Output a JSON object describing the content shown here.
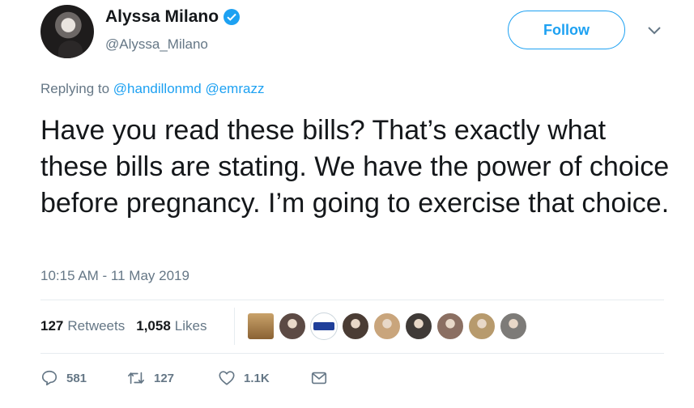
{
  "user": {
    "display_name": "Alyssa Milano",
    "handle": "@Alyssa_Milano",
    "verified_icon": "verified-badge-icon"
  },
  "follow_label": "Follow",
  "reply_context": {
    "prefix": "Replying to",
    "mentions": [
      "@handillonmd",
      "@emrazz"
    ]
  },
  "tweet": {
    "text": "Have you read these bills? That’s exactly what these bills are stating. We have the power of choice before pregnancy. I’m going to exercise that choice.",
    "timestamp": "10:15 AM - 11 May 2019"
  },
  "stats": {
    "retweets_count": "127",
    "retweets_label": "Retweets",
    "likes_count": "1,058",
    "likes_label": "Likes"
  },
  "likers": [
    {
      "icon": "tv-avatar",
      "color": "#a87b44"
    },
    {
      "icon": "avatar",
      "color": "#5c4a44"
    },
    {
      "icon": "sign-avatar",
      "color": "#1f3f9a"
    },
    {
      "icon": "avatar",
      "color": "#4a3c34"
    },
    {
      "icon": "avatar",
      "color": "#c9a57c"
    },
    {
      "icon": "avatar",
      "color": "#3f3a37"
    },
    {
      "icon": "avatar",
      "color": "#8b6f62"
    },
    {
      "icon": "avatar",
      "color": "#b79a6d"
    },
    {
      "icon": "avatar",
      "color": "#7d7b78"
    }
  ],
  "actions": {
    "replies": "581",
    "retweets": "127",
    "likes": "1.1K"
  },
  "colors": {
    "accent": "#1da1f2",
    "secondary_text": "#657786",
    "primary_text": "#14171a"
  }
}
